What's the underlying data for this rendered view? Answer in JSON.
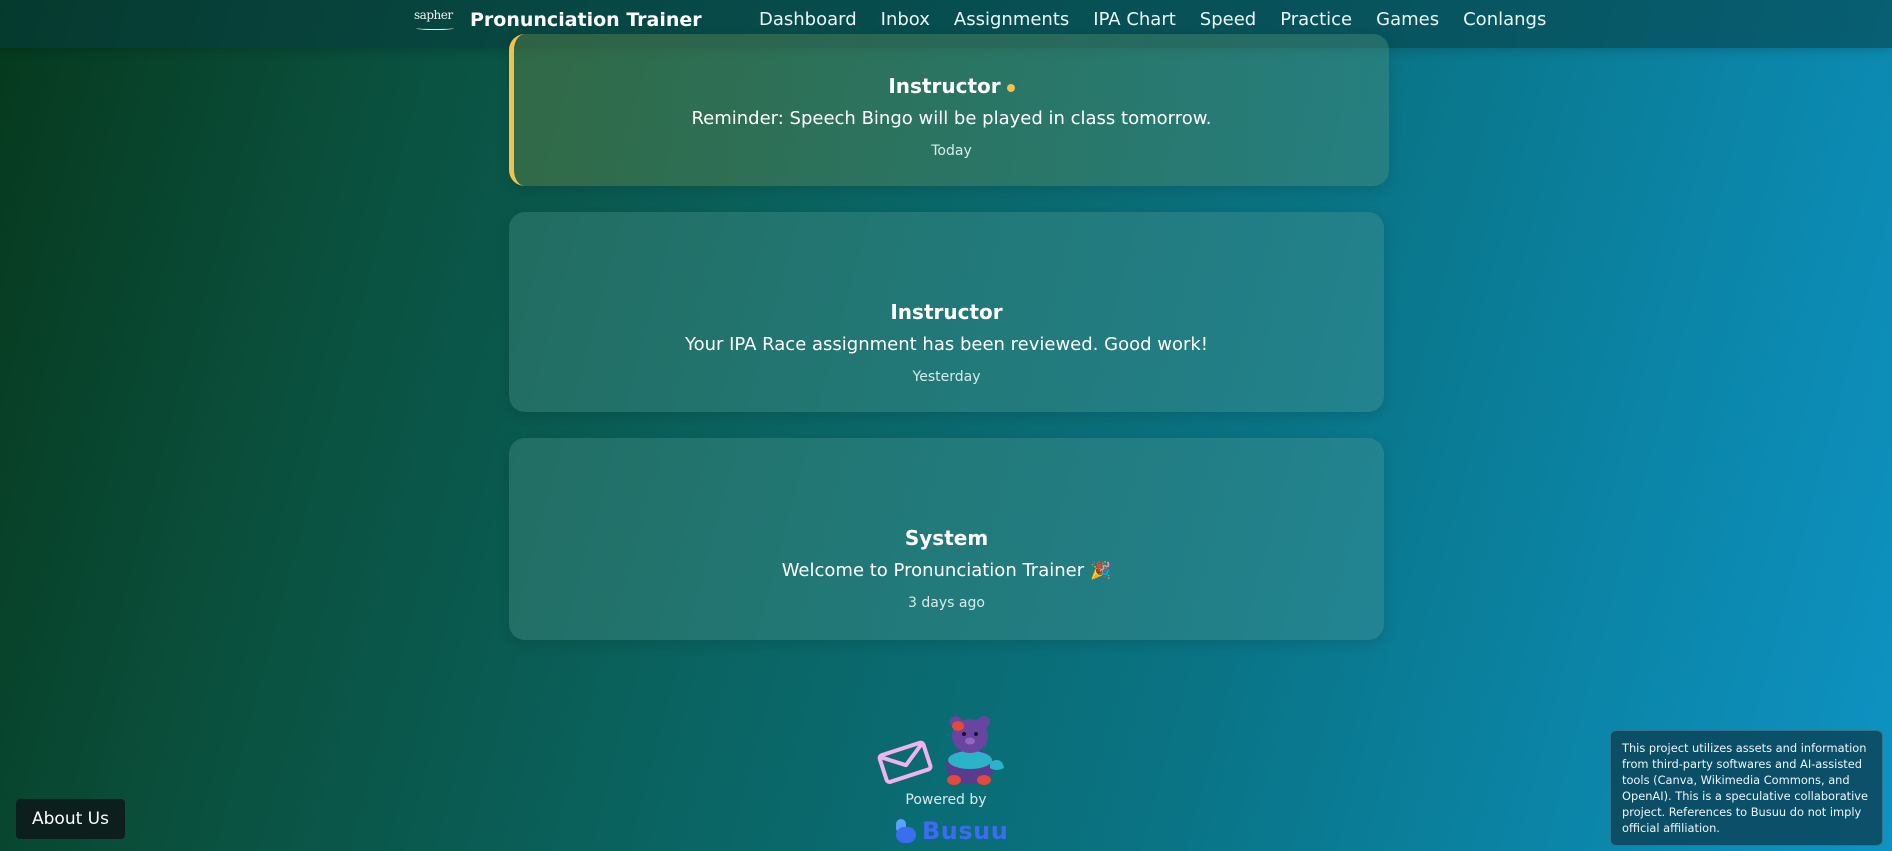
{
  "header": {
    "logo_text": "sapher",
    "app_title": "Pronunciation Trainer",
    "nav": [
      {
        "label": "Dashboard"
      },
      {
        "label": "Inbox"
      },
      {
        "label": "Assignments"
      },
      {
        "label": "IPA Chart"
      },
      {
        "label": "Speed"
      },
      {
        "label": "Practice"
      },
      {
        "label": "Games"
      },
      {
        "label": "Conlangs"
      }
    ]
  },
  "messages": [
    {
      "sender": "Instructor",
      "text": "Reminder: Speech Bingo will be played in class tomorrow.",
      "time": "Today",
      "unread": true
    },
    {
      "sender": "Instructor",
      "text": "Your IPA Race assignment has been reviewed. Good work!",
      "time": "Yesterday",
      "unread": false
    },
    {
      "sender": "System",
      "text": "Welcome to Pronunciation Trainer",
      "time": "3 days ago",
      "unread": false,
      "icon": "party-popper-icon"
    }
  ],
  "footer": {
    "powered_by": "Powered by",
    "brand": "Busuu",
    "about_label": "About Us",
    "disclaimer": "This project utilizes assets and information from third-party softwares and AI-assisted tools (Canva, Wikimedia Commons, and OpenAI). This is a speculative collaborative project. References to Busuu do not imply official affiliation."
  },
  "colors": {
    "accent_unread": "#f2c14e",
    "busuu_blue": "#3b6df0"
  }
}
